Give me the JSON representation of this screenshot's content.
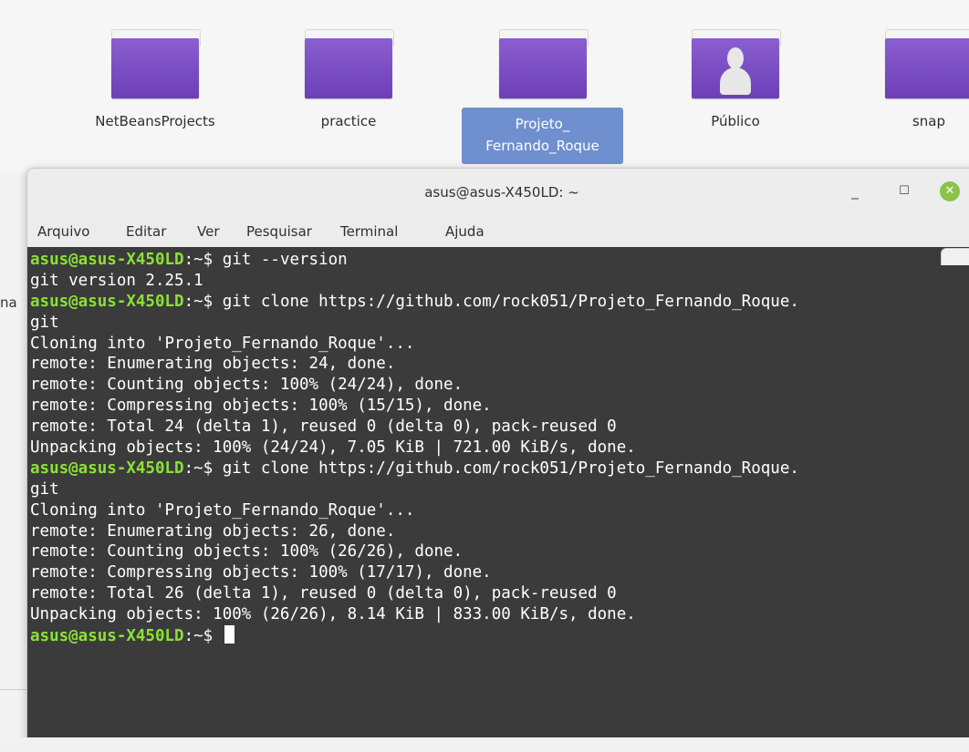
{
  "desktop": {
    "folders": [
      {
        "label": "NetBeansProjects"
      },
      {
        "label": "practice"
      },
      {
        "label_line1": "Projeto_",
        "label_line2": "Fernando_Roque"
      },
      {
        "label": "Público"
      },
      {
        "label": "snap"
      }
    ],
    "left_fragment": "na"
  },
  "window": {
    "title": "asus@asus-X450LD: ~",
    "minimize": "_",
    "maximize": "☐",
    "close": "✕"
  },
  "menu": {
    "items": [
      "Arquivo",
      "Editar",
      "Ver",
      "Pesquisar",
      "Terminal",
      "Ajuda"
    ]
  },
  "terminal": {
    "prompt_user": "asus@asus-X450LD",
    "prompt_path": ":~$ ",
    "lines": [
      {
        "prompt": true,
        "text": "git --version"
      },
      {
        "prompt": false,
        "text": "git version 2.25.1"
      },
      {
        "prompt": true,
        "text": "git clone https://github.com/rock051/Projeto_Fernando_Roque."
      },
      {
        "prompt": false,
        "text": "git"
      },
      {
        "prompt": false,
        "text": "Cloning into 'Projeto_Fernando_Roque'..."
      },
      {
        "prompt": false,
        "text": "remote: Enumerating objects: 24, done."
      },
      {
        "prompt": false,
        "text": "remote: Counting objects: 100% (24/24), done."
      },
      {
        "prompt": false,
        "text": "remote: Compressing objects: 100% (15/15), done."
      },
      {
        "prompt": false,
        "text": "remote: Total 24 (delta 1), reused 0 (delta 0), pack-reused 0"
      },
      {
        "prompt": false,
        "text": "Unpacking objects: 100% (24/24), 7.05 KiB | 721.00 KiB/s, done."
      },
      {
        "prompt": true,
        "text": "git clone https://github.com/rock051/Projeto_Fernando_Roque."
      },
      {
        "prompt": false,
        "text": "git"
      },
      {
        "prompt": false,
        "text": "Cloning into 'Projeto_Fernando_Roque'..."
      },
      {
        "prompt": false,
        "text": "remote: Enumerating objects: 26, done."
      },
      {
        "prompt": false,
        "text": "remote: Counting objects: 100% (26/26), done."
      },
      {
        "prompt": false,
        "text": "remote: Compressing objects: 100% (17/17), done."
      },
      {
        "prompt": false,
        "text": "remote: Total 26 (delta 1), reused 0 (delta 0), pack-reused 0"
      },
      {
        "prompt": false,
        "text": "Unpacking objects: 100% (26/26), 8.14 KiB | 833.00 KiB/s, done."
      }
    ],
    "current_input": ""
  }
}
